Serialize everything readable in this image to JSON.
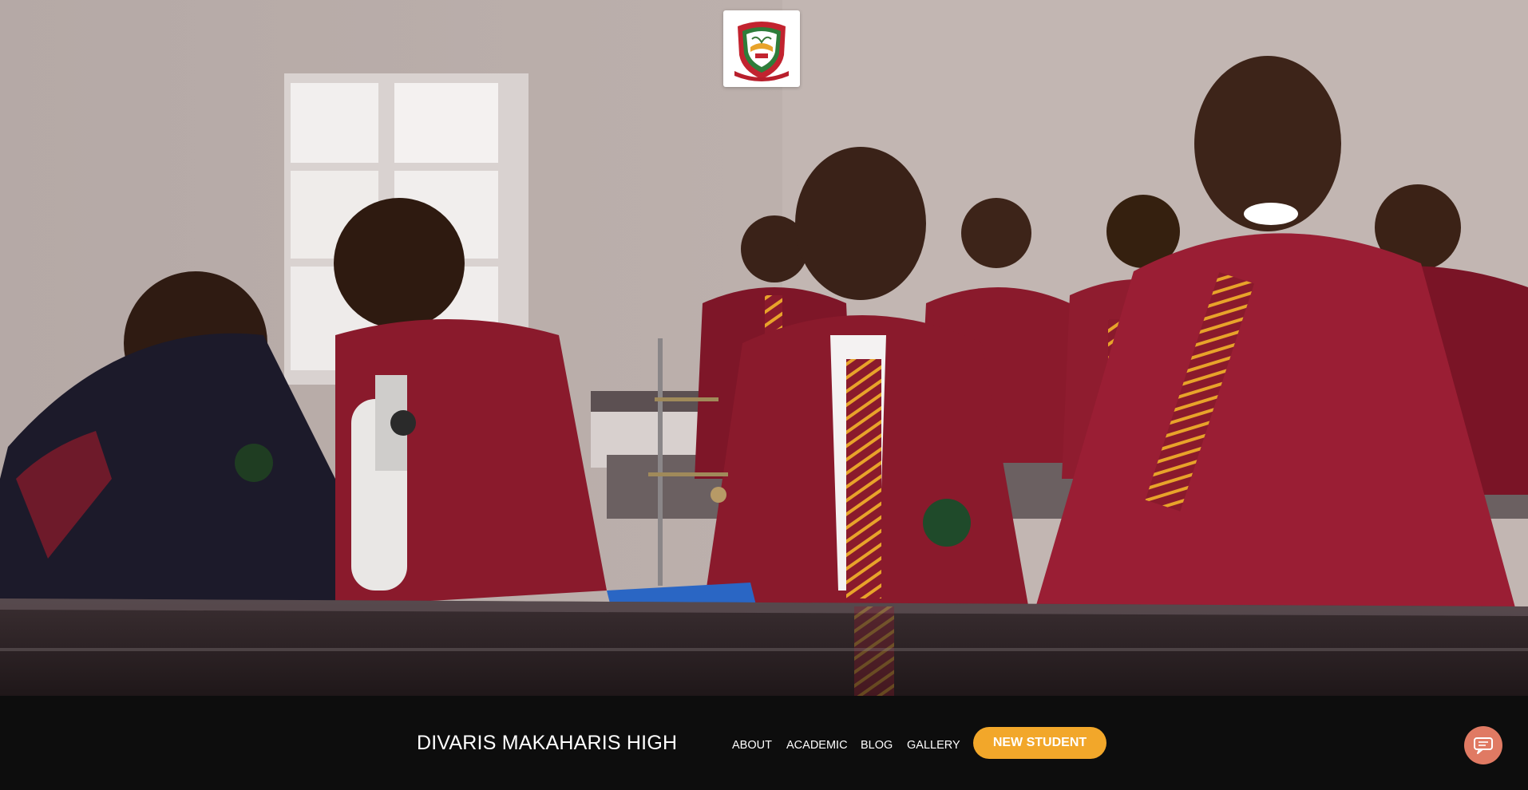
{
  "hero": {
    "scene": "students-science-lab-photo",
    "colors": {
      "wall": "#b8aca8",
      "blazer": "#8a1a2c",
      "tie_stripe": "#e8a32a",
      "bench": "#2a2224"
    }
  },
  "logo": {
    "icon": "school-crest-icon"
  },
  "nav": {
    "brand": "DIVARIS MAKAHARIS HIGH",
    "links": [
      {
        "label": "ABOUT"
      },
      {
        "label": "ACADEMIC"
      },
      {
        "label": "BLOG"
      },
      {
        "label": "GALLERY"
      }
    ],
    "cta_label": "NEW STUDENT",
    "chat_icon": "chat-bubble-icon",
    "colors": {
      "bar": "#0d0d0d",
      "cta": "#f2a72a",
      "chat": "#e07a63"
    }
  }
}
